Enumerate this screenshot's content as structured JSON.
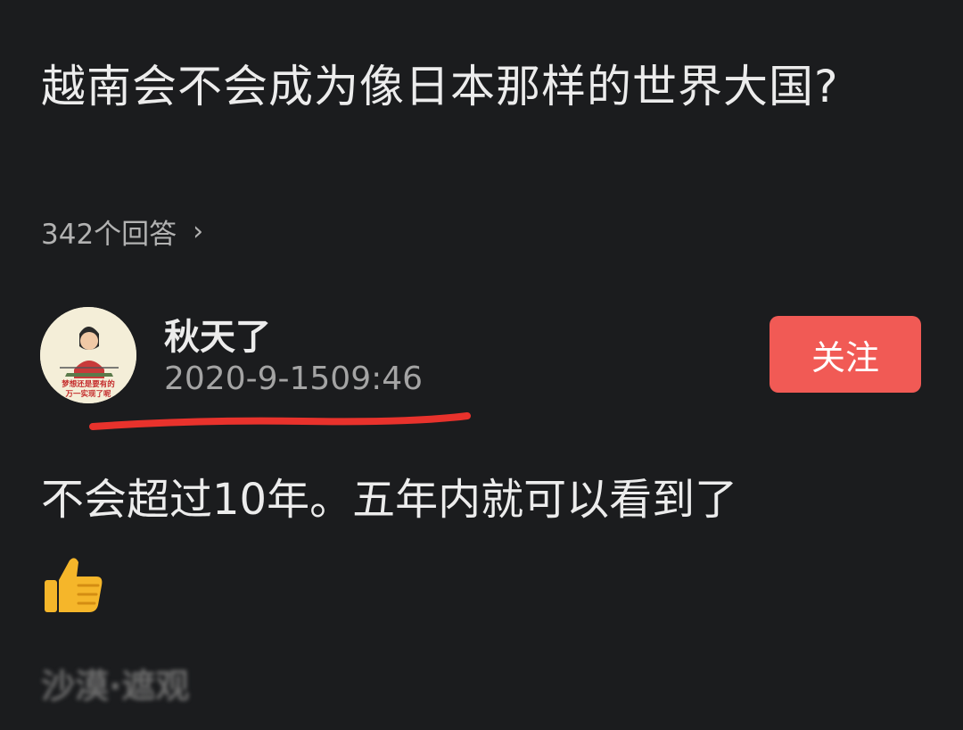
{
  "question": {
    "title": "越南会不会成为像日本那样的世界大国?",
    "answer_count": "342个回答",
    "chevron": "›"
  },
  "answer": {
    "author": {
      "name": "秋天了",
      "time": "2020-9-1509:46",
      "avatar_caption_line1": "梦想还是要有的",
      "avatar_caption_line2": "万一实现了呢"
    },
    "follow_label": "关注",
    "body": "不会超过10年。五年内就可以看到了",
    "emoji_name": "thumbs-up-icon"
  },
  "footer": {
    "blurred_text": "沙漠·遮观"
  },
  "colors": {
    "background": "#1b1c1e",
    "follow_button": "#f15a55",
    "underline": "#e8322c"
  }
}
